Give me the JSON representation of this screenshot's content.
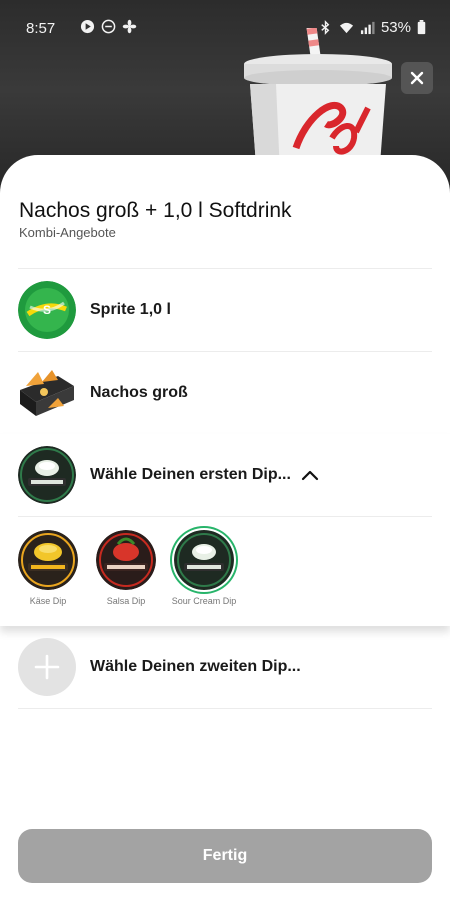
{
  "status_bar": {
    "time": "8:57",
    "battery": "53%"
  },
  "header": {
    "title": "Nachos groß + 1,0 l Softdrink",
    "subtitle": "Kombi-Angebote"
  },
  "items": [
    {
      "label": "Sprite 1,0 l",
      "icon": "sprite-bottle-logo"
    },
    {
      "label": "Nachos groß",
      "icon": "nachos-box-image"
    }
  ],
  "dip1": {
    "label": "Wähle Deinen ersten Dip...",
    "icon": "sour-cream-dip-logo",
    "expanded": true,
    "options": [
      {
        "label": "Käse Dip",
        "selected": false
      },
      {
        "label": "Salsa Dip",
        "selected": false
      },
      {
        "label": "Sour Cream Dip",
        "selected": true
      }
    ]
  },
  "dip2": {
    "label": "Wähle Deinen zweiten Dip...",
    "icon": "plus-icon"
  },
  "done_label": "Fertig",
  "colors": {
    "selected_ring": "#27b46a",
    "button_disabled": "#a3a3a3",
    "sprite_green": "#1f9a3e"
  }
}
